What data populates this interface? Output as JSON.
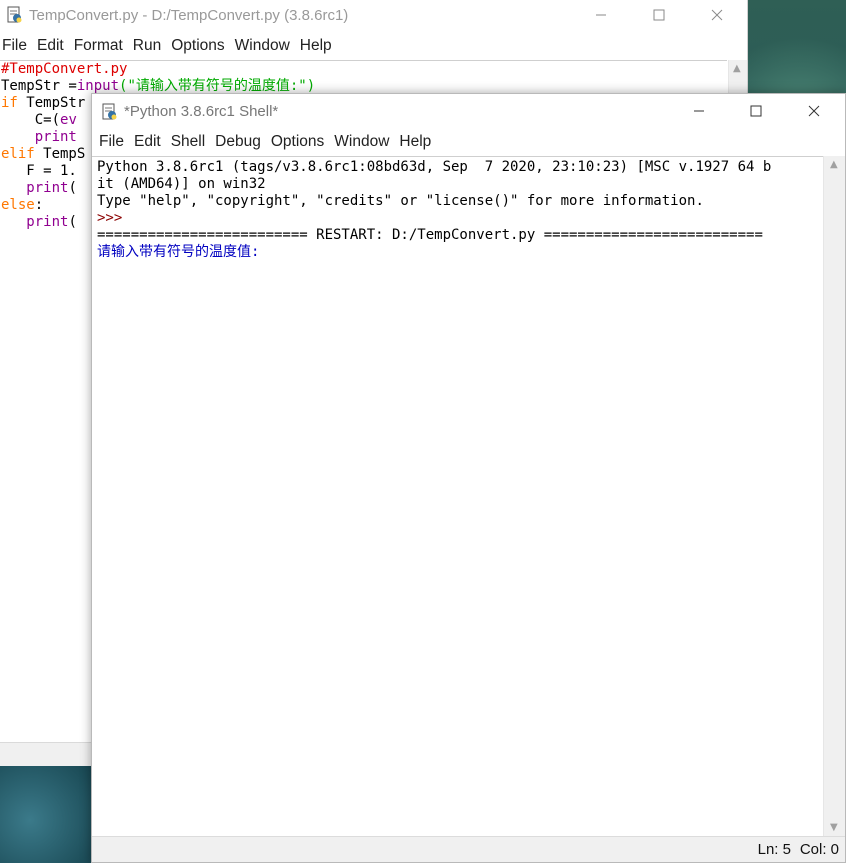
{
  "editor": {
    "title": "TempConvert.py - D:/TempConvert.py (3.8.6rc1)",
    "menu": [
      "File",
      "Edit",
      "Format",
      "Run",
      "Options",
      "Window",
      "Help"
    ],
    "code": [
      [
        {
          "t": "#TempConvert.py",
          "c": "comment"
        }
      ],
      [
        {
          "t": "TempStr =",
          "c": "plain"
        },
        {
          "t": "input",
          "c": "builtin"
        },
        {
          "t": "(\"请输入带有符号的温度值:\")",
          "c": "str"
        }
      ],
      [
        {
          "t": "if",
          "c": "kw"
        },
        {
          "t": " TempStr",
          "c": "plain"
        }
      ],
      [
        {
          "t": "    C=(",
          "c": "plain"
        },
        {
          "t": "ev",
          "c": "builtin"
        }
      ],
      [
        {
          "t": "    ",
          "c": "plain"
        },
        {
          "t": "print",
          "c": "builtin"
        }
      ],
      [
        {
          "t": "elif",
          "c": "kw"
        },
        {
          "t": " TempS",
          "c": "plain"
        }
      ],
      [
        {
          "t": "   F = 1.",
          "c": "plain"
        }
      ],
      [
        {
          "t": "   ",
          "c": "plain"
        },
        {
          "t": "print",
          "c": "builtin"
        },
        {
          "t": "(",
          "c": "plain"
        }
      ],
      [
        {
          "t": "else",
          "c": "kw"
        },
        {
          "t": ":",
          "c": "plain"
        }
      ],
      [
        {
          "t": "   ",
          "c": "plain"
        },
        {
          "t": "print",
          "c": "builtin"
        },
        {
          "t": "(",
          "c": "plain"
        }
      ]
    ]
  },
  "shell": {
    "title": "*Python 3.8.6rc1 Shell*",
    "menu": [
      "File",
      "Edit",
      "Shell",
      "Debug",
      "Options",
      "Window",
      "Help"
    ],
    "lines": [
      {
        "t": "Python 3.8.6rc1 (tags/v3.8.6rc1:08bd63d, Sep  7 2020, 23:10:23) [MSC v.1927 64 b",
        "c": "plain"
      },
      {
        "t": "it (AMD64)] on win32",
        "c": "plain"
      },
      {
        "t": "Type \"help\", \"copyright\", \"credits\" or \"license()\" for more information.",
        "c": "plain"
      },
      {
        "t": ">>> ",
        "c": "prompt"
      },
      {
        "t": "========================= RESTART: D:/TempConvert.py ==========================",
        "c": "plain"
      },
      {
        "t": "请输入带有符号的温度值:",
        "c": "stdout"
      }
    ],
    "status": {
      "ln": "Ln: 5",
      "col": "Col: 0"
    }
  },
  "colors": {
    "comment": "#dd0000",
    "keyword": "#ff7700",
    "builtin": "#900090",
    "string": "#00aa00",
    "prompt": "#8b0000",
    "stdout": "#0000c0"
  },
  "icons": {
    "app": "python-idle-icon",
    "minimize": "minimize-icon",
    "maximize": "maximize-icon",
    "close": "close-icon"
  }
}
